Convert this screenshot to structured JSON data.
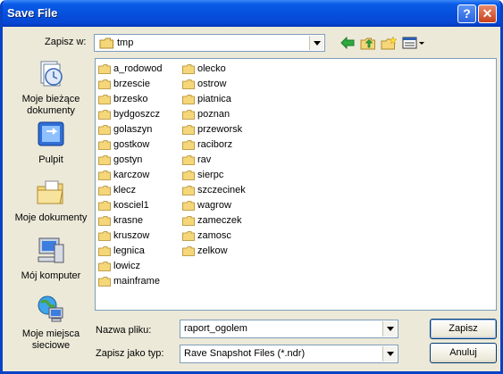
{
  "window": {
    "title": "Save File"
  },
  "titlebar_buttons": {
    "help": "?",
    "close": "✕"
  },
  "lookin": {
    "label": "Zapisz w:",
    "value": "tmp"
  },
  "toolbar": {
    "back_icon": "back-arrow-icon",
    "up_icon": "up-folder-icon",
    "new_folder_icon": "new-folder-icon",
    "views_icon": "views-menu-icon"
  },
  "places": [
    {
      "label": "Moje bieżące dokumenty",
      "icon": "recent-documents-icon"
    },
    {
      "label": "Pulpit",
      "icon": "desktop-icon"
    },
    {
      "label": "Moje dokumenty",
      "icon": "my-documents-icon"
    },
    {
      "label": "Mój komputer",
      "icon": "my-computer-icon"
    },
    {
      "label": "Moje miejsca sieciowe",
      "icon": "network-places-icon"
    }
  ],
  "folders_col1": [
    "a_rodowod",
    "brzescie",
    "brzesko",
    "bydgoszcz",
    "golaszyn",
    "gostkow",
    "gostyn",
    "karczow",
    "klecz",
    "kosciel1",
    "krasne",
    "kruszow",
    "legnica",
    "lowicz",
    "mainframe"
  ],
  "folders_col2": [
    "olecko",
    "ostrow",
    "piatnica",
    "poznan",
    "przeworsk",
    "raciborz",
    "rav",
    "sierpc",
    "szczecinek",
    "wagrow",
    "zameczek",
    "zamosc",
    "zelkow"
  ],
  "filename": {
    "label": "Nazwa pliku:",
    "value": "raport_ogolem"
  },
  "filetype": {
    "label": "Zapisz jako typ:",
    "value": "Rave Snapshot Files (*.ndr)"
  },
  "buttons": {
    "save": "Zapisz",
    "cancel": "Anuluj"
  },
  "colors": {
    "title_blue": "#0550dc",
    "dialog_bg": "#ece9d8",
    "folder_yellow": "#f5d77a",
    "close_red": "#c8401c"
  }
}
